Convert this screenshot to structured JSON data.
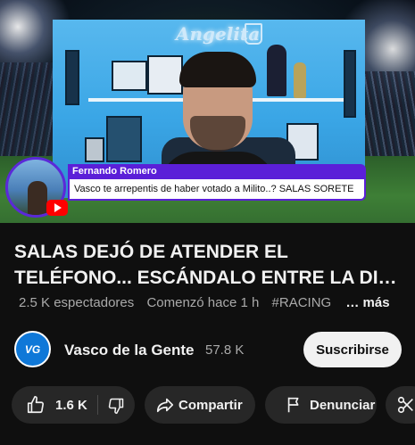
{
  "video": {
    "overlay_brand": "Angelita",
    "superchat": {
      "name": "Fernando Romero",
      "message": "Vasco te arrepentis de haber votado a Milito..? SALAS SORETE",
      "accent_color": "#5b1fd8"
    }
  },
  "details": {
    "title_lines": [
      "SALAS DEJÓ DE ATENDER EL",
      "TELÉFONO... ESCÁNDALO ENTRE LA DI…"
    ],
    "viewers": "2.5 K espectadores",
    "started": "Comenzó hace 1 h",
    "hashtag": "#RACING",
    "more": "… más"
  },
  "channel": {
    "logo_text": "VG",
    "name": "Vasco de la Gente",
    "subscribers": "57.8 K",
    "subscribe_label": "Suscribirse"
  },
  "actions": {
    "like_count": "1.6 K",
    "share_label": "Compartir",
    "report_label": "Denunciar",
    "icons": [
      "thumbs-up-icon",
      "thumbs-down-icon",
      "share-arrow-icon",
      "flag-icon",
      "scissors-icon"
    ]
  },
  "colors": {
    "background": "#0f0f0f",
    "pill": "#272727",
    "subscribe_bg": "#f1f1f1",
    "secondary_text": "#aaaaaa"
  }
}
